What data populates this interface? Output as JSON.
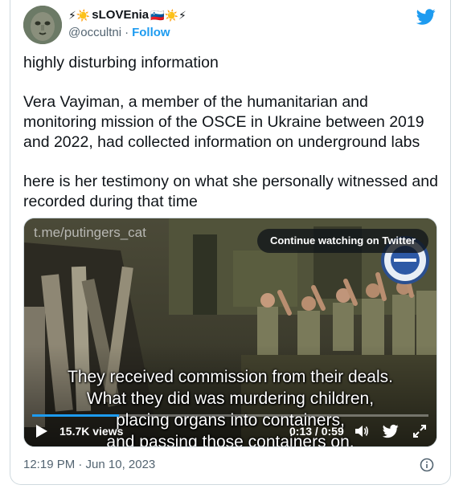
{
  "author": {
    "display_name": "sLOVEnia",
    "name_emojis_left": "⚡☀️",
    "name_emojis_right": "🇸🇮☀️⚡",
    "handle": "@occultni",
    "separator": "·",
    "follow_label": "Follow"
  },
  "tweet": {
    "paragraphs": [
      "highly disturbing information",
      "Vera Vayiman, a member of the humanitarian and monitoring mission of the OSCE in Ukraine between 2019 and 2022, had collected information on underground labs",
      "here is her testimony on what she personally witnessed and recorded during that time"
    ]
  },
  "media": {
    "watermark": "t.me/putingers_cat",
    "continue_label": "Continue watching on Twitter",
    "subtitle_lines": [
      "They received commission from their deals.",
      "What they did was murdering children,",
      "placing organs into containers,",
      "and passing those containers on."
    ],
    "views": "15.7K views",
    "time_current": "0:13",
    "time_separator": "/",
    "time_total": "0:59",
    "progress": 0.22
  },
  "footer": {
    "timestamp": "12:19 PM · Jun 10, 2023"
  },
  "icons": {
    "twitter": "twitter-bird-icon",
    "play": "play-icon",
    "volume": "volume-icon",
    "twitter_small": "twitter-bird-small-icon",
    "fullscreen": "fullscreen-icon",
    "info": "info-icon"
  },
  "colors": {
    "brand": "#1d9bf0",
    "text": "#0f1419",
    "secondary": "#536471"
  }
}
